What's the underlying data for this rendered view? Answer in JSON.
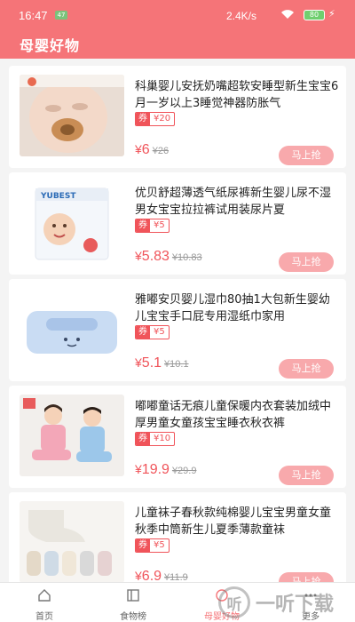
{
  "status": {
    "time": "16:47",
    "badge": "47",
    "speed": "2.4K/s",
    "battery": "80"
  },
  "header": {
    "title": "母婴好物"
  },
  "products": [
    {
      "name": "科巢婴儿安抚奶嘴超软安睡型新生宝宝6月一岁以上3睡觉神器防胀气",
      "coupon_key": "券",
      "coupon_value": "¥20",
      "price_symbol": "¥",
      "price": "6",
      "original": "¥26",
      "buy_label": "马上抢"
    },
    {
      "name": "优贝舒超薄透气纸尿裤新生婴儿尿不湿男女宝宝拉拉裤试用装尿片夏",
      "coupon_key": "券",
      "coupon_value": "¥5",
      "price_symbol": "¥",
      "price": "5.83",
      "original": "¥10.83",
      "buy_label": "马上抢"
    },
    {
      "name": "雅嘟安贝婴儿湿巾80抽1大包新生婴幼儿宝宝手口屁专用湿纸巾家用",
      "coupon_key": "券",
      "coupon_value": "¥5",
      "price_symbol": "¥",
      "price": "5.1",
      "original": "¥10.1",
      "buy_label": "马上抢"
    },
    {
      "name": "嘟嘟童话无痕儿童保暖内衣套装加绒中厚男童女童孩宝宝睡衣秋衣裤",
      "coupon_key": "券",
      "coupon_value": "¥10",
      "price_symbol": "¥",
      "price": "19.9",
      "original": "¥29.9",
      "buy_label": "马上抢"
    },
    {
      "name": "儿童袜子春秋款纯棉婴儿宝宝男童女童秋季中筒新生儿夏季薄款童袜",
      "coupon_key": "券",
      "coupon_value": "¥5",
      "price_symbol": "¥",
      "price": "6.9",
      "original": "¥11.9",
      "buy_label": "马上抢"
    }
  ],
  "thumb_text": {
    "yubest": "YUBEST"
  },
  "tabs": [
    {
      "label": "首页",
      "icon": "home-icon"
    },
    {
      "label": "食物榜",
      "icon": "list-icon"
    },
    {
      "label": "母婴好物",
      "icon": "baby-icon"
    },
    {
      "label": "更多",
      "icon": "more-icon"
    }
  ],
  "watermark": {
    "mark": "听",
    "text": "一听下载"
  },
  "colors": {
    "accent": "#f57478",
    "price": "#f0545a"
  }
}
